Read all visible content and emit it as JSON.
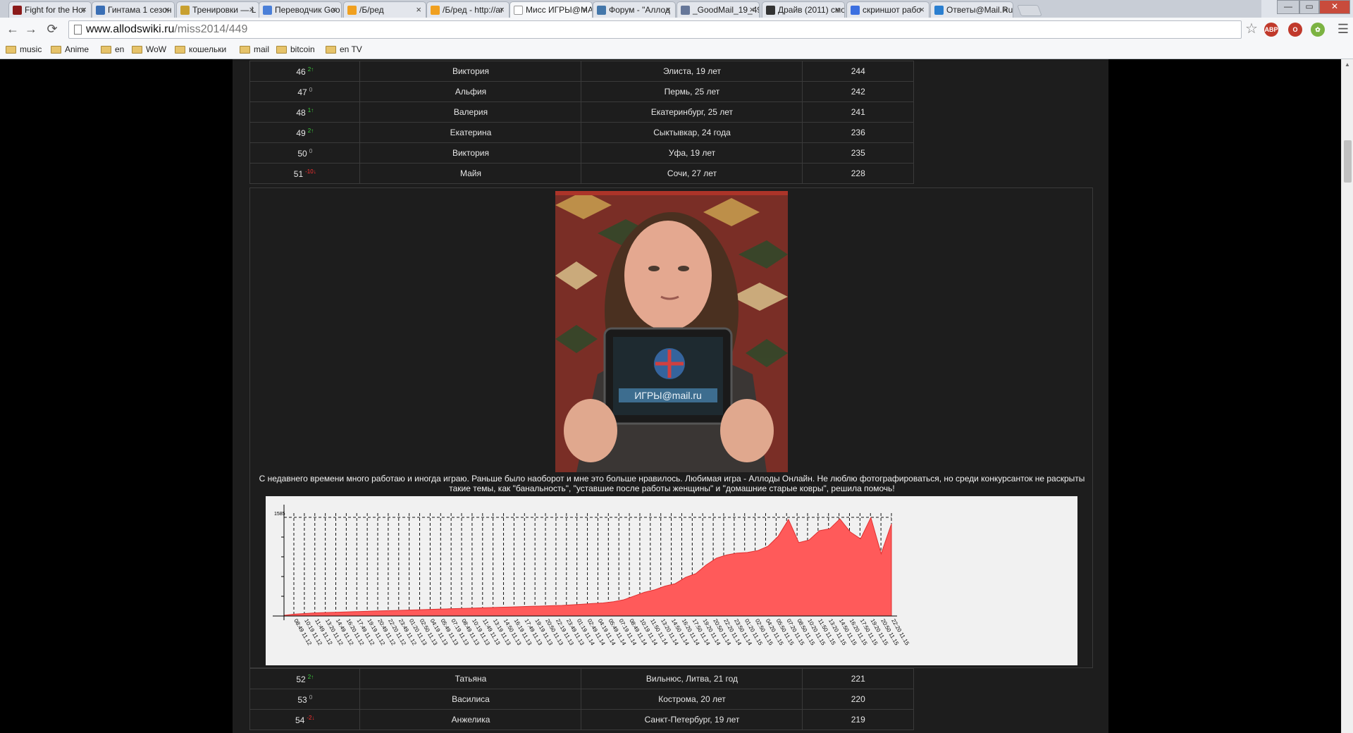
{
  "browser": {
    "tabs": [
      {
        "title": "Fight for the Hor",
        "color": "#8b1a1a"
      },
      {
        "title": "Гинтама 1 сезон",
        "color": "#3a6fb5"
      },
      {
        "title": "Тренировки — L",
        "color": "#c8a030"
      },
      {
        "title": "Переводчик Goo",
        "color": "#4a7fd8"
      },
      {
        "title": "/Б/ред",
        "color": "#f0a020"
      },
      {
        "title": "/Б/ред - http://ar",
        "color": "#f0a020"
      },
      {
        "title": "Мисс ИГРЫ@МА",
        "color": "#ffffff"
      },
      {
        "title": "Форум - \"Аллод",
        "color": "#4477aa"
      },
      {
        "title": "_GoodMail_19_49",
        "color": "#667799"
      },
      {
        "title": "Драйв (2011) смо",
        "color": "#333333"
      },
      {
        "title": "скриншот рабо",
        "color": "#3b6fe0"
      },
      {
        "title": "Ответы@Mail.Ru",
        "color": "#2a7fd0"
      }
    ],
    "active_tab": 6,
    "url_host": "www.allodswiki.ru",
    "url_path": "/miss2014/449",
    "extensions": [
      {
        "label": "ABP",
        "color": "#c0392b"
      },
      {
        "label": "O",
        "color": "#c0392b"
      },
      {
        "label": "✿",
        "color": "#7cb342"
      }
    ],
    "bookmarks": [
      "music",
      "Anime",
      "en",
      "WoW",
      "кошельки",
      "mail",
      "bitcoin",
      "en TV"
    ]
  },
  "ranking_top": [
    {
      "place": "46",
      "delta": "2",
      "dir": "up",
      "name": "Виктория",
      "city": "Элиста, 19 лет",
      "score": "244"
    },
    {
      "place": "47",
      "delta": "0",
      "dir": "zero",
      "name": "Альфия",
      "city": "Пермь, 25 лет",
      "score": "242"
    },
    {
      "place": "48",
      "delta": "1",
      "dir": "up",
      "name": "Валерия",
      "city": "Екатеринбург, 25 лет",
      "score": "241"
    },
    {
      "place": "49",
      "delta": "2",
      "dir": "up",
      "name": "Екатерина",
      "city": "Сыктывкар, 24 года",
      "score": "236"
    },
    {
      "place": "50",
      "delta": "0",
      "dir": "zero",
      "name": "Виктория",
      "city": "Уфа, 19 лет",
      "score": "235"
    },
    {
      "place": "51",
      "delta": "-10",
      "dir": "down",
      "name": "Майя",
      "city": "Сочи, 27 лет",
      "score": "228"
    }
  ],
  "ranking_bottom": [
    {
      "place": "52",
      "delta": "2",
      "dir": "up",
      "name": "Татьяна",
      "city": "Вильнюс, Литва, 21 год",
      "score": "221"
    },
    {
      "place": "53",
      "delta": "0",
      "dir": "zero",
      "name": "Василиса",
      "city": "Кострома, 20 лет",
      "score": "220"
    },
    {
      "place": "54",
      "delta": "-2",
      "dir": "down",
      "name": "Анжелика",
      "city": "Санкт-Петербург, 19 лет",
      "score": "219"
    }
  ],
  "photo": {
    "tablet_text": "ИГРЫ@mail.ru"
  },
  "caption": "С недавнего времени много работаю и иногда играю. Раньше было наоборот и мне это больше нравилось. Любимая игра - Аллоды Онлайн. Не люблю фотографироваться, но среди конкурсанток не раскрыты такие темы, как \"банальность\", \"уставшие после работы женщины\" и \"домашние старые ковры\", решила помочь!",
  "chart_data": {
    "type": "area",
    "color": "#ff5a5a",
    "y_max_label": "1585",
    "ylim": [
      0,
      1585
    ],
    "x": [
      "08:49 11.12",
      "10:19 11.12",
      "11:49 11.12",
      "13:20 11.12",
      "14:49 11.12",
      "16:20 11.12",
      "17:49 11.12",
      "19:19 11.12",
      "20:49 11.12",
      "22:20 11.12",
      "23:49 11.12",
      "01:20 11.13",
      "02:50 11.13",
      "04:19 11.13",
      "05:49 11.13",
      "07:19 11.13",
      "08:49 11.13",
      "10:19 11.13",
      "11:49 11.13",
      "13:19 11.13",
      "14:50 11.13",
      "16:19 11.13",
      "17:49 11.13",
      "19:19 11.13",
      "20:50 11.13",
      "22:19 11.13",
      "23:49 11.13",
      "01:19 11.14",
      "02:49 11.14",
      "04:19 11.14",
      "05:49 11.14",
      "07:19 11.14",
      "08:49 11.14",
      "10:19 11.14",
      "11:50 11.14",
      "13:20 11.14",
      "14:50 11.14",
      "16:20 11.14",
      "17:50 11.14",
      "19:20 11.14",
      "20:50 11.14",
      "22:20 11.14",
      "23:50 11.14",
      "01:20 11.15",
      "02:50 11.15",
      "04:20 11.15",
      "05:50 11.15",
      "07:20 11.15",
      "08:50 11.15",
      "10:20 11.15",
      "11:50 11.15",
      "13:20 11.15",
      "14:50 11.15",
      "16:20 11.15",
      "17:50 11.15",
      "19:20 11.15",
      "20:50 11.15",
      "22:20 11.15"
    ],
    "y": [
      10,
      30,
      40,
      50,
      55,
      60,
      65,
      70,
      75,
      80,
      85,
      90,
      95,
      100,
      105,
      110,
      115,
      120,
      125,
      130,
      135,
      140,
      145,
      150,
      155,
      160,
      165,
      170,
      180,
      190,
      200,
      210,
      230,
      260,
      320,
      380,
      420,
      480,
      520,
      620,
      680,
      820,
      930,
      980,
      1010,
      1020,
      1050,
      1120,
      1280,
      1550,
      1180,
      1220,
      1370,
      1400,
      1560,
      1350,
      1240,
      1580,
      1000,
      1480
    ],
    "grid": true
  }
}
